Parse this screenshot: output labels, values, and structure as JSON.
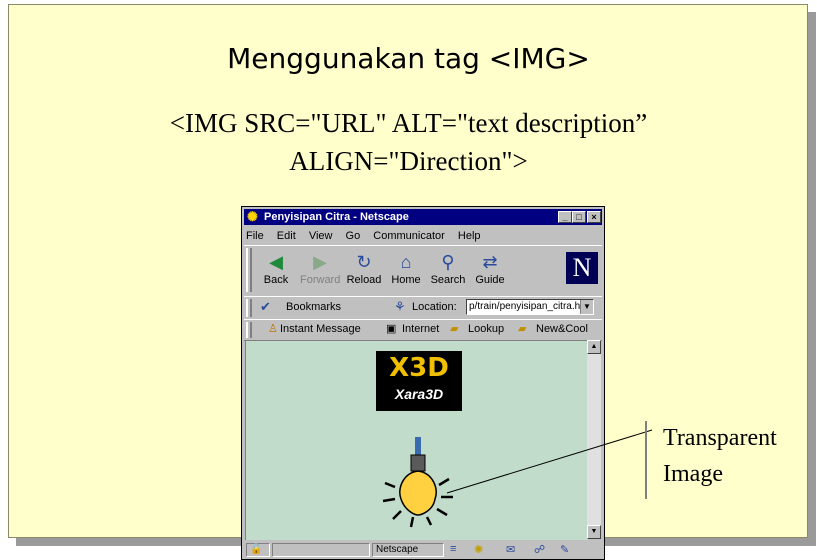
{
  "slide": {
    "title": "Menggunakan tag <IMG>",
    "code_line1": "<IMG SRC=\"URL\" ALT=\"text description”",
    "code_line2": "ALIGN=\"Direction\">"
  },
  "browser": {
    "window_title": "Penyisipan Citra - Netscape",
    "window_buttons": [
      "_",
      "□",
      "×"
    ],
    "menu": [
      "File",
      "Edit",
      "View",
      "Go",
      "Communicator",
      "Help"
    ],
    "toolbar": [
      "Back",
      "Forward",
      "Reload",
      "Home",
      "Search",
      "Guide"
    ],
    "logo_letter": "N",
    "bookmarks_label": "Bookmarks",
    "location_label": "Location:",
    "location_value": "p/train/penyisipan_citra.htm",
    "personal": [
      "Instant Message",
      "Internet",
      "Lookup",
      "New&Cool"
    ],
    "image_text_top": "X3D",
    "image_text_bottom": "Xara3D",
    "status_text": "Netscape"
  },
  "callout": {
    "line1": "Transparent",
    "line2": "Image"
  },
  "colors": {
    "slide_bg": "#ffffcc",
    "titlebar": "#000080",
    "content_bg": "#c2dccc"
  }
}
